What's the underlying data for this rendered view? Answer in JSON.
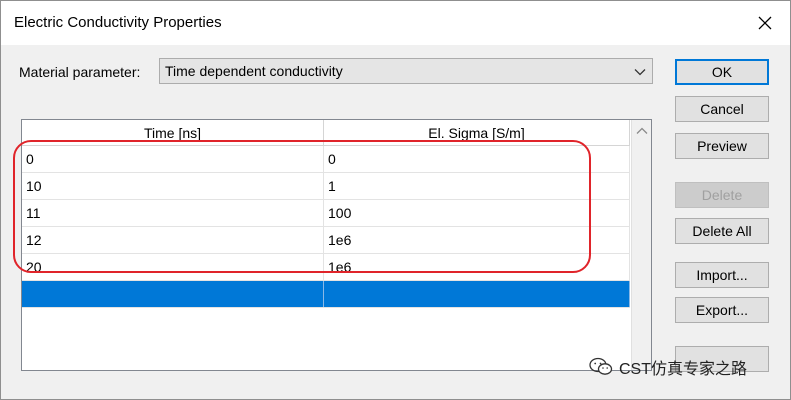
{
  "window": {
    "title": "Electric Conductivity Properties",
    "close_icon": "close-icon"
  },
  "material": {
    "label": "Material parameter:",
    "selected": "Time dependent conductivity",
    "dropdown_icon": "chevron-down-icon"
  },
  "buttons": {
    "ok": "OK",
    "cancel": "Cancel",
    "preview": "Preview",
    "delete": "Delete",
    "delete_all": "Delete All",
    "import": "Import...",
    "export": "Export..."
  },
  "table": {
    "columns": [
      "Time [ns]",
      "El. Sigma [S/m]"
    ],
    "rows": [
      [
        "0",
        "0"
      ],
      [
        "10",
        "1"
      ],
      [
        "11",
        "100"
      ],
      [
        "12",
        "1e6"
      ],
      [
        "20",
        "1e6"
      ]
    ],
    "selected_row_color": "#0078d7"
  },
  "annotation": {
    "highlight_color": "#e0242a"
  },
  "watermark": {
    "text": "CST仿真专家之路",
    "icon": "wechat-icon"
  }
}
